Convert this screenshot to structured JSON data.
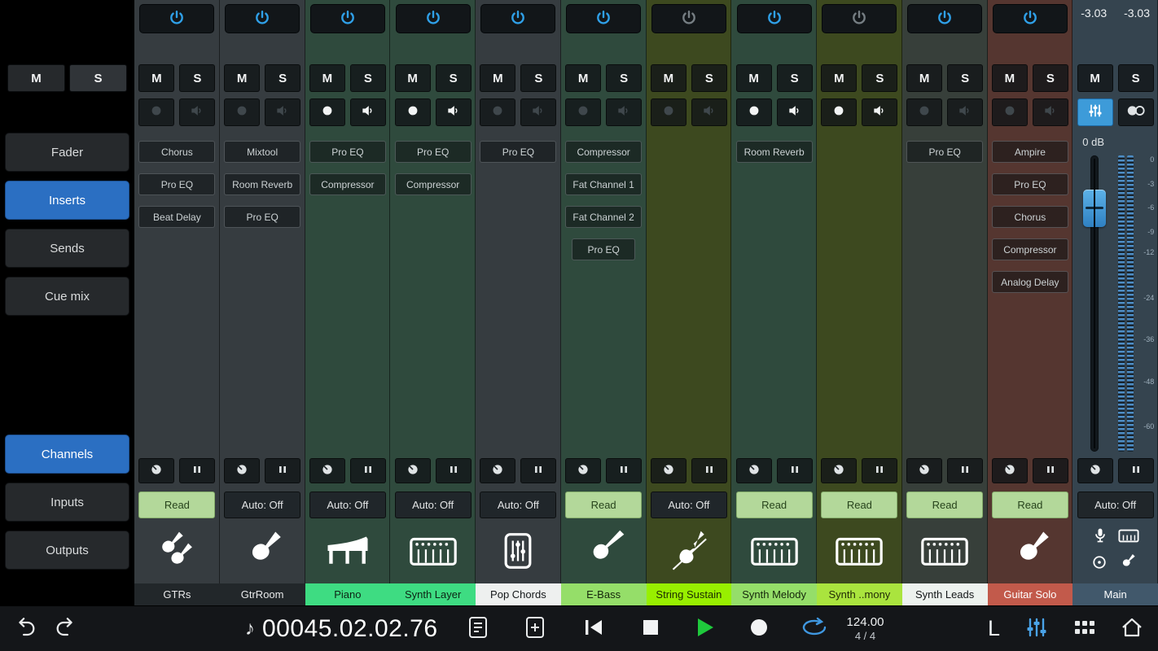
{
  "labels": {
    "mute": "M",
    "solo": "S"
  },
  "sidebar": {
    "mute": "M",
    "solo": "S",
    "views": [
      {
        "label": "Fader",
        "active": false
      },
      {
        "label": "Inserts",
        "active": true
      },
      {
        "label": "Sends",
        "active": false
      },
      {
        "label": "Cue mix",
        "active": false
      }
    ],
    "lists": [
      {
        "label": "Channels",
        "active": true
      },
      {
        "label": "Inputs",
        "active": false
      },
      {
        "label": "Outputs",
        "active": false
      }
    ]
  },
  "channels": [
    {
      "name": "GTRs",
      "icon": "dual-guitars-icon",
      "tint": "#363c40",
      "label_bg": "#22272a",
      "label_color": "#e9eaeb",
      "power_on": true,
      "rec_on": false,
      "mon_on": false,
      "inserts": [
        {
          "label": "Chorus"
        },
        {
          "label": "Pro EQ"
        },
        {
          "label": "Beat Delay"
        }
      ],
      "automation": "Read",
      "automation_state": "read"
    },
    {
      "name": "GtrRoom",
      "icon": "electric-guitar-icon",
      "tint": "#363c40",
      "label_bg": "#22272a",
      "label_color": "#e9eaeb",
      "power_on": true,
      "rec_on": false,
      "mon_on": false,
      "inserts": [
        {
          "label": "Mixtool"
        },
        {
          "label": "Room Reverb"
        },
        {
          "label": "Pro EQ"
        }
      ],
      "automation": "Auto: Off",
      "automation_state": "off"
    },
    {
      "name": "Piano",
      "icon": "grand-piano-icon",
      "tint": "#2f4a3d",
      "label_bg": "#3edc82",
      "label_color": "#0d2415",
      "power_on": true,
      "rec_on": true,
      "mon_on": true,
      "inserts": [
        {
          "label": "Pro EQ"
        },
        {
          "label": "Compressor"
        }
      ],
      "automation": "Auto: Off",
      "automation_state": "off"
    },
    {
      "name": "Synth Layer",
      "icon": "synth-keyboard-icon",
      "tint": "#2f4a3d",
      "label_bg": "#3edc82",
      "label_color": "#0d2415",
      "power_on": true,
      "rec_on": true,
      "mon_on": true,
      "inserts": [
        {
          "label": "Pro EQ"
        },
        {
          "label": "Compressor"
        }
      ],
      "automation": "Auto: Off",
      "automation_state": "off"
    },
    {
      "name": "Pop Chords",
      "icon": "sliders-icon",
      "tint": "#363c40",
      "label_bg": "#eef0ef",
      "label_color": "#141719",
      "power_on": true,
      "rec_on": false,
      "mon_on": false,
      "inserts": [
        {
          "label": "Pro EQ"
        }
      ],
      "automation": "Auto: Off",
      "automation_state": "off"
    },
    {
      "name": "E-Bass",
      "icon": "bass-guitar-icon",
      "tint": "#2f4a3d",
      "label_bg": "#95de69",
      "label_color": "#15260b",
      "power_on": true,
      "rec_on": false,
      "mon_on": false,
      "inserts": [
        {
          "label": "Compressor"
        },
        {
          "label": "Fat Channel 1"
        },
        {
          "label": "Fat Channel 2"
        },
        {
          "label": "Pro EQ",
          "indent": true
        }
      ],
      "automation": "Read",
      "automation_state": "read"
    },
    {
      "name": "String Sustain",
      "icon": "violin-icon",
      "tint": "#3d491f",
      "label_bg": "#98ef00",
      "label_color": "#1d2b02",
      "power_on": false,
      "rec_on": false,
      "mon_on": false,
      "inserts": [],
      "automation": "Auto: Off",
      "automation_state": "off"
    },
    {
      "name": "Synth Melody",
      "icon": "synth-keyboard-icon",
      "tint": "#2f4a3d",
      "label_bg": "#95de69",
      "label_color": "#15260b",
      "power_on": true,
      "rec_on": true,
      "mon_on": true,
      "inserts": [
        {
          "label": "Room Reverb"
        }
      ],
      "automation": "Read",
      "automation_state": "read"
    },
    {
      "name": "Synth ..mony",
      "icon": "synth-keyboard-icon",
      "tint": "#3d491f",
      "label_bg": "#aae43e",
      "label_color": "#222b06",
      "power_on": false,
      "rec_on": true,
      "mon_on": true,
      "inserts": [],
      "automation": "Read",
      "automation_state": "read"
    },
    {
      "name": "Synth Leads",
      "icon": "synth-keyboard-icon",
      "tint": "#373f3a",
      "label_bg": "#edf2ee",
      "label_color": "#141719",
      "power_on": true,
      "rec_on": false,
      "mon_on": false,
      "inserts": [
        {
          "label": "Pro EQ"
        }
      ],
      "automation": "Read",
      "automation_state": "read"
    },
    {
      "name": "Guitar Solo",
      "icon": "electric-guitar-icon",
      "tint": "#553630",
      "label_bg": "#c25a4b",
      "label_color": "#ffffff",
      "power_on": true,
      "rec_on": false,
      "mon_on": false,
      "inserts": [
        {
          "label": "Ampire"
        },
        {
          "label": "Pro EQ"
        },
        {
          "label": "Chorus"
        },
        {
          "label": "Compressor"
        },
        {
          "label": "Analog Delay"
        }
      ],
      "automation": "Read",
      "automation_state": "read"
    }
  ],
  "main": {
    "name": "Main",
    "peak_left": "-3.03",
    "peak_right": "-3.03",
    "fader_value": "0 dB",
    "automation": "Auto: Off",
    "label_bg": "#41586b",
    "label_color": "#ffffff",
    "meter_ticks": [
      "0",
      "-3",
      "-6",
      "-9",
      "-12",
      "-24",
      "-36",
      "-48",
      "-60"
    ]
  },
  "transport": {
    "time": "00045.02.02.76",
    "tempo": "124.00",
    "signature": "4 / 4",
    "layout_label": "L"
  },
  "colors": {
    "accent_blue": "#2b6fc2",
    "power_blue": "#2fa0e8",
    "power_off": "#767e83",
    "icon_bright": "#f2f4f4",
    "icon_dim": "#3f474c",
    "read_green": "#b3d89a",
    "play_green": "#1fc93c",
    "loop_blue": "#3f97e0",
    "fader_blue": "#4aa4e0"
  }
}
